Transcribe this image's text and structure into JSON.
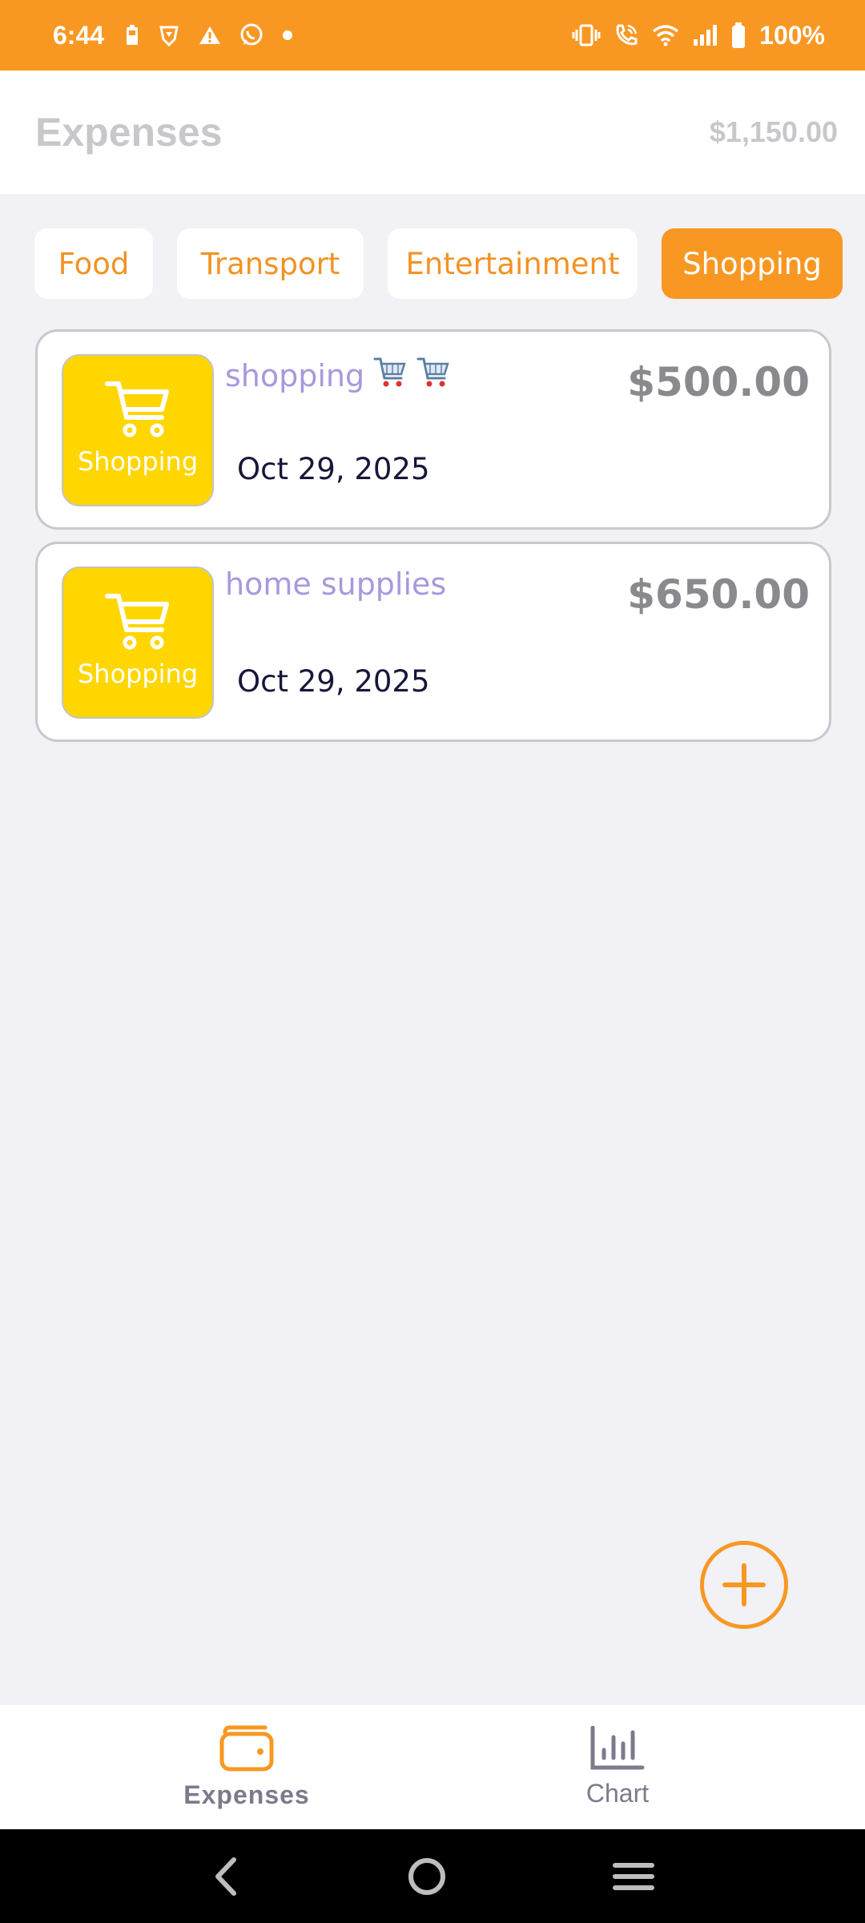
{
  "status_bar": {
    "time": "6:44",
    "battery_text": "100%",
    "left_icons": [
      "battery-saver-icon",
      "brave-icon",
      "alert-icon",
      "whatsapp-icon",
      "dot-icon"
    ],
    "right_icons": [
      "vibrate-icon",
      "wifi-call-icon",
      "wifi-icon",
      "signal-icon",
      "battery-icon"
    ]
  },
  "header": {
    "title": "Expenses",
    "total": "$1,150.00"
  },
  "categories": {
    "selected": "Shopping",
    "items": [
      {
        "label": "Food"
      },
      {
        "label": "Transport"
      },
      {
        "label": "Entertainment"
      },
      {
        "label": "Shopping"
      }
    ]
  },
  "expenses": [
    {
      "category": "Shopping",
      "title": "shopping",
      "title_emoji_count": 2,
      "date": "Oct 29, 2025",
      "amount": "$500.00"
    },
    {
      "category": "Shopping",
      "title": "home supplies",
      "title_emoji_count": 0,
      "date": "Oct 29, 2025",
      "amount": "$650.00"
    }
  ],
  "fab": {
    "icon": "plus-circle-icon"
  },
  "bottom_nav": {
    "active": "Expenses",
    "items": [
      {
        "label": "Expenses",
        "icon": "wallet-icon"
      },
      {
        "label": "Chart",
        "icon": "bar-chart-icon"
      }
    ]
  },
  "system_nav": {
    "icons": [
      "back-icon",
      "home-icon",
      "recents-icon"
    ]
  },
  "colors": {
    "accent": "#f89823",
    "category_tile": "#ffd600",
    "title_text": "#a998dd",
    "amount_text": "#8a8a8e"
  }
}
